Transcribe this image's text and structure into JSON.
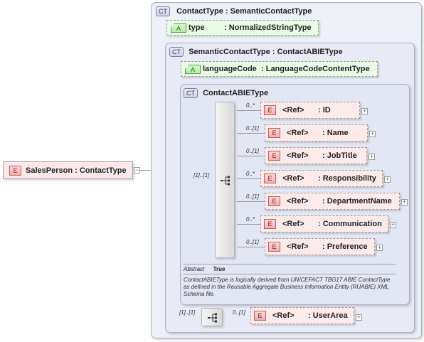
{
  "root": {
    "badge": "E",
    "label": "SalesPerson : ContactType",
    "toggle": "−"
  },
  "outer_type": {
    "badge": "CT",
    "label": "ContactType : SemanticContactType"
  },
  "type_attr": {
    "badge": "A",
    "name": "type",
    "type": ": NormalizedStringType"
  },
  "semantic_type": {
    "badge": "CT",
    "label": "SemanticContactType : ContactABIEType"
  },
  "lang_attr": {
    "badge": "A",
    "name": "languageCode",
    "type": ": LanguageCodeContentType"
  },
  "abie_type": {
    "badge": "CT",
    "label": "ContactABIEType",
    "sequence_cardinality": "[1]..[1]",
    "abstract_key": "Abstract",
    "abstract_value": "True",
    "description": "ContactABIEType is logically derived from UN/CEFACT TBG17 ABIE ContactType as defined in the Reusable Aggregate Business Information Entity (RUABIE) XML Schema file."
  },
  "elements": [
    {
      "card": "0..*",
      "badge": "E",
      "ref": "<Ref>",
      "name": ": ID"
    },
    {
      "card": "0..[1]",
      "badge": "E",
      "ref": "<Ref>",
      "name": ": Name"
    },
    {
      "card": "0..[1]",
      "badge": "E",
      "ref": "<Ref>",
      "name": ": JobTitle"
    },
    {
      "card": "0..*",
      "badge": "E",
      "ref": "<Ref>",
      "name": ": Responsibility"
    },
    {
      "card": "0..[1]",
      "badge": "E",
      "ref": "<Ref>",
      "name": ": DepartmentName"
    },
    {
      "card": "0..*",
      "badge": "E",
      "ref": "<Ref>",
      "name": ": Communication"
    },
    {
      "card": "0..[1]",
      "badge": "E",
      "ref": "<Ref>",
      "name": ": Preference"
    }
  ],
  "user_area": {
    "sequence_cardinality": "[1]..[1]",
    "card": "0..[1]",
    "badge": "E",
    "ref": "<Ref>",
    "name": ": UserArea"
  },
  "expand_symbol": "+"
}
